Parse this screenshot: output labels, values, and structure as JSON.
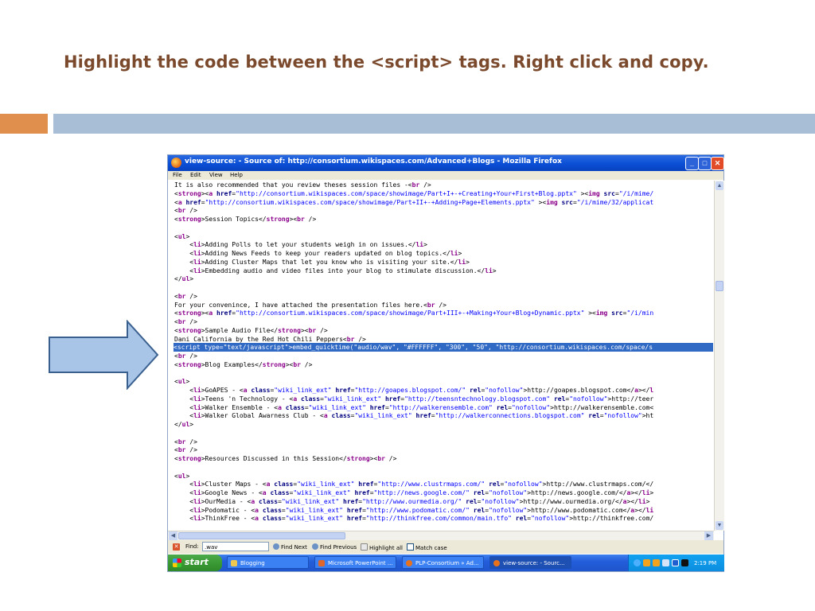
{
  "slide": {
    "title": "Highlight the code between the <script> tags.  Right click and copy."
  },
  "colors": {
    "title": "#7b4a2d",
    "bar_orange": "#e08f4d",
    "bar_blue": "#a8bed6",
    "arrow_fill": "#a8c4e6",
    "arrow_stroke": "#3a6090",
    "highlight": "#316ac5"
  },
  "window": {
    "title": "view-source: - Source of: http://consortium.wikispaces.com/Advanced+Blogs - Mozilla Firefox",
    "menu": [
      "File",
      "Edit",
      "View",
      "Help"
    ]
  },
  "source_lines": [
    {
      "text": "It is also recommended that you review theses session files -<br />"
    },
    {
      "text": "<strong><a href=\"http://consortium.wikispaces.com/space/showimage/Part+I+-+Creating+Your+First+Blog.pptx\" ><img src=\"/i/mime/"
    },
    {
      "text": "<a href=\"http://consortium.wikispaces.com/space/showimage/Part+II+-+Adding+Page+Elements.pptx\" ><img src=\"/i/mime/32/applicat"
    },
    {
      "text": "<br />"
    },
    {
      "text": "<strong>Session Topics</strong><br />"
    },
    {
      "text": ""
    },
    {
      "text": "<ul>"
    },
    {
      "text": "    <li>Adding Polls to let your students weigh in on issues.</li>"
    },
    {
      "text": "    <li>Adding News Feeds to keep your readers updated on blog topics.</li>"
    },
    {
      "text": "    <li>Adding Cluster Maps that let you know who is visiting your site.</li>"
    },
    {
      "text": "    <li>Embedding audio and video files into your blog to stimulate discussion.</li>"
    },
    {
      "text": "</ul>"
    },
    {
      "text": ""
    },
    {
      "text": "<br />"
    },
    {
      "text": "For your convenince, I have attached the presentation files here.<br />"
    },
    {
      "text": "<strong><a href=\"http://consortium.wikispaces.com/space/showimage/Part+III+-+Making+Your+Blog+Dynamic.pptx\" ><img src=\"/i/min"
    },
    {
      "text": "<br />"
    },
    {
      "text": "<strong>Sample Audio File</strong><br />"
    },
    {
      "text": "Dani California by the Red Hot Chili Peppers<br />"
    },
    {
      "text": "<script type=\"text/javascript\">embed_quicktime(\"audio/wav\", \"#FFFFFF\", \"300\", \"50\", \"http://consortium.wikispaces.com/space/s",
      "highlight": true
    },
    {
      "text": "<br />"
    },
    {
      "text": "<strong>Blog Examples</strong><br />"
    },
    {
      "text": ""
    },
    {
      "text": "<ul>"
    },
    {
      "text": "    <li>GoAPES - <a class=\"wiki_link_ext\" href=\"http://goapes.blogspot.com/\" rel=\"nofollow\">http://goapes.blogspot.com</a></l"
    },
    {
      "text": "    <li>Teens 'n Technology - <a class=\"wiki_link_ext\" href=\"http://teensntechnology.blogspot.com\" rel=\"nofollow\">http://teer"
    },
    {
      "text": "    <li>Walker Ensemble - <a class=\"wiki_link_ext\" href=\"http://walkerensemble.com\" rel=\"nofollow\">http://walkerensemble.com<"
    },
    {
      "text": "    <li>Walker Global Awarness Club - <a class=\"wiki_link_ext\" href=\"http://walkerconnections.blogspot.com\" rel=\"nofollow\">ht"
    },
    {
      "text": "</ul>"
    },
    {
      "text": ""
    },
    {
      "text": "<br />"
    },
    {
      "text": "<br />"
    },
    {
      "text": "<strong>Resources Discussed in this Session</strong><br />"
    },
    {
      "text": ""
    },
    {
      "text": "<ul>"
    },
    {
      "text": "    <li>Cluster Maps - <a class=\"wiki_link_ext\" href=\"http://www.clustrmaps.com/\" rel=\"nofollow\">http://www.clustrmaps.com/</"
    },
    {
      "text": "    <li>Google News - <a class=\"wiki_link_ext\" href=\"http://news.google.com/\" rel=\"nofollow\">http://news.google.com/</a></li>"
    },
    {
      "text": "    <li>OurMedia - <a class=\"wiki_link_ext\" href=\"http://www.ourmedia.org/\" rel=\"nofollow\">http://www.ourmedia.org/</a></li>"
    },
    {
      "text": "    <li>Podomatic - <a class=\"wiki_link_ext\" href=\"http://www.podomatic.com/\" rel=\"nofollow\">http://www.podomatic.com</a></li"
    },
    {
      "text": "    <li>ThinkFree - <a class=\"wiki_link_ext\" href=\"http://thinkfree.com/common/main.tfo\" rel=\"nofollow\">http://thinkfree.com/"
    }
  ],
  "findbar": {
    "label": "Find:",
    "value": ".wav",
    "next": "Find Next",
    "previous": "Find Previous",
    "highlight_all": "Highlight all",
    "match_case": "Match case"
  },
  "taskbar": {
    "start": "start",
    "tasks": [
      {
        "label": "Blogging",
        "icon": "folder-icon",
        "color": "#f0c850"
      },
      {
        "label": "Microsoft PowerPoint ...",
        "icon": "powerpoint-icon",
        "color": "#e0662a"
      },
      {
        "label": "PLP-Consortium » Ad...",
        "icon": "firefox-icon",
        "color": "#e8721c"
      },
      {
        "label": "view-source: - Sourc...",
        "icon": "firefox-icon",
        "color": "#e8721c",
        "active": true
      }
    ],
    "clock": "2:19 PM"
  }
}
